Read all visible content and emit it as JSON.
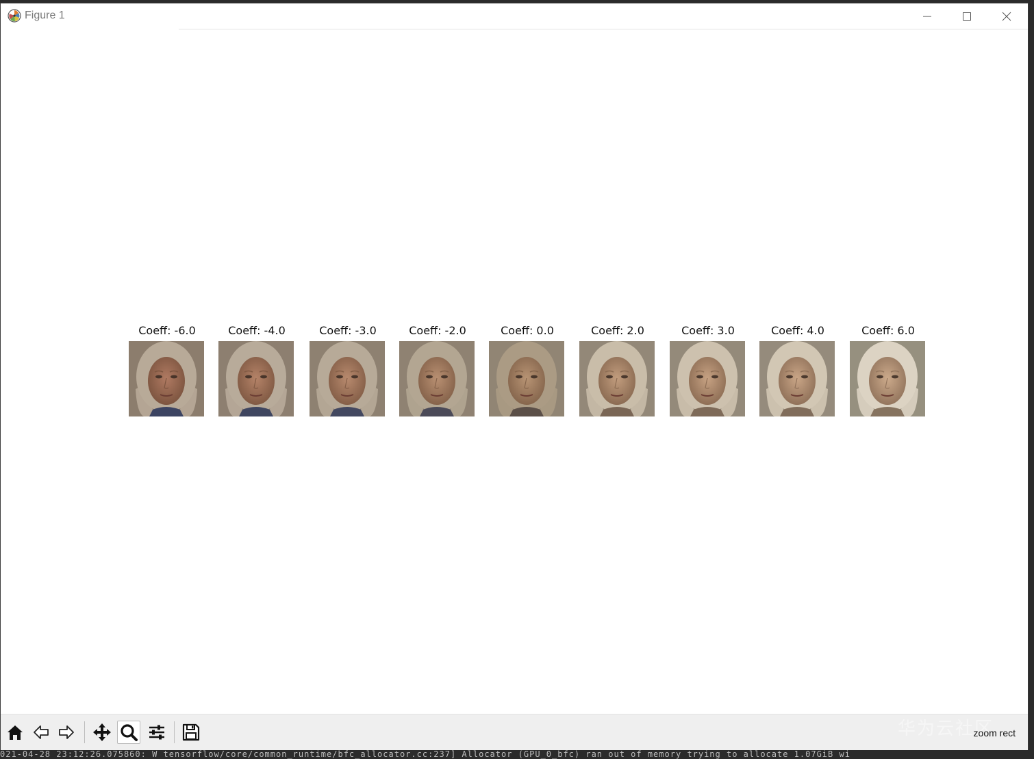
{
  "window": {
    "title": "Figure 1"
  },
  "figure": {
    "panels": [
      {
        "title": "Coeff: -6.0",
        "palette": {
          "bg": "#8c7d6d",
          "hair": "#b8aa98",
          "skin": "#b07a62",
          "shadow": "#7d5540",
          "shirt": "#3c4462"
        }
      },
      {
        "title": "Coeff: -4.0",
        "palette": {
          "bg": "#8d7f70",
          "hair": "#b8ab9a",
          "skin": "#b58368",
          "shadow": "#815a44",
          "shirt": "#3f4660"
        }
      },
      {
        "title": "Coeff: -3.0",
        "palette": {
          "bg": "#8e8171",
          "hair": "#b7aa98",
          "skin": "#b88a6e",
          "shadow": "#855f48",
          "shirt": "#434860"
        }
      },
      {
        "title": "Coeff: -2.0",
        "palette": {
          "bg": "#8f8272",
          "hair": "#b3a692",
          "skin": "#b99072",
          "shadow": "#86634b",
          "shirt": "#4b4a58"
        }
      },
      {
        "title": "Coeff: 0.0",
        "palette": {
          "bg": "#918574",
          "hair": "#ab9b84",
          "skin": "#b89474",
          "shadow": "#86664d",
          "shirt": "#5b4f48"
        }
      },
      {
        "title": "Coeff: 2.0",
        "palette": {
          "bg": "#938878",
          "hair": "#c9bda9",
          "skin": "#c29d7e",
          "shadow": "#8c6c53",
          "shirt": "#7a6655"
        }
      },
      {
        "title": "Coeff: 3.0",
        "palette": {
          "bg": "#948a7a",
          "hair": "#cdc1ae",
          "skin": "#c7a283",
          "shadow": "#8f6f56",
          "shirt": "#7e6a58"
        }
      },
      {
        "title": "Coeff: 4.0",
        "palette": {
          "bg": "#958b7c",
          "hair": "#d2c7b4",
          "skin": "#caa687",
          "shadow": "#91725a",
          "shirt": "#816d5b"
        }
      },
      {
        "title": "Coeff: 6.0",
        "palette": {
          "bg": "#96907f",
          "hair": "#dcd3c3",
          "skin": "#ccaa8b",
          "shadow": "#94765e",
          "shirt": "#86735f"
        }
      }
    ]
  },
  "toolbar": {
    "status": "zoom rect",
    "buttons": [
      {
        "name": "home-icon"
      },
      {
        "name": "back-arrow-icon"
      },
      {
        "name": "forward-arrow-icon"
      },
      {
        "name": "pan-icon"
      },
      {
        "name": "zoom-icon"
      },
      {
        "name": "configure-subplots-icon"
      },
      {
        "name": "save-icon"
      }
    ]
  },
  "watermark": "华为云社区",
  "terminal_line": "021-04-28 23:12:26.075860: W tensorflow/core/common_runtime/bfc_allocator.cc:237] Allocator (GPU_0_bfc) ran out of memory trying to allocate 1.07GiB wi"
}
